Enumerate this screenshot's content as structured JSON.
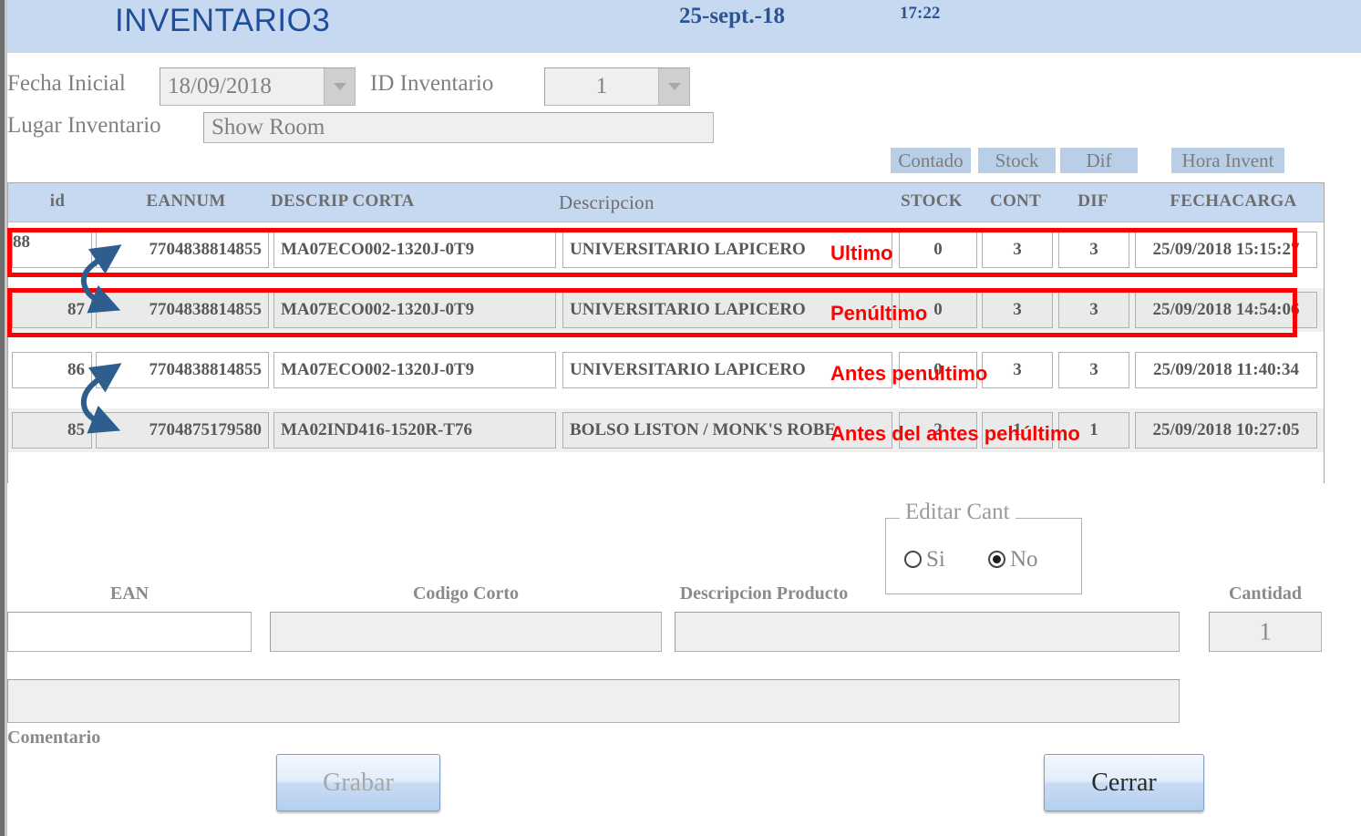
{
  "window": {
    "title": "INVENTARIO3",
    "header_date": "25-sept.-18",
    "header_time": "17:22"
  },
  "form_top": {
    "fecha_inicial_label": "Fecha Inicial",
    "fecha_inicial_value": "18/09/2018",
    "id_inventario_label": "ID Inventario",
    "id_inventario_value": "1",
    "lugar_inventario_label": "Lugar Inventario",
    "lugar_inventario_value": "Show Room"
  },
  "chips": [
    {
      "label": "Contado"
    },
    {
      "label": "Stock"
    },
    {
      "label": "Dif"
    },
    {
      "label": "Hora Invent"
    }
  ],
  "grid": {
    "columns": [
      "id",
      "EANNUM",
      "DESCRIP CORTA",
      "Descripcion",
      "STOCK",
      "CONT",
      "DIF",
      "FECHACARGA"
    ],
    "rows": [
      {
        "id": "88",
        "eannum": "7704838814855",
        "descrip_corta": "MA07ECO002-1320J-0T9",
        "descripcion": "UNIVERSITARIO LAPICERO",
        "stock": "0",
        "cont": "3",
        "dif": "3",
        "fechacarga": "25/09/2018 15:15:27"
      },
      {
        "id": "87",
        "eannum": "7704838814855",
        "descrip_corta": "MA07ECO002-1320J-0T9",
        "descripcion": "UNIVERSITARIO LAPICERO",
        "stock": "0",
        "cont": "3",
        "dif": "3",
        "fechacarga": "25/09/2018 14:54:06"
      },
      {
        "id": "86",
        "eannum": "7704838814855",
        "descrip_corta": "MA07ECO002-1320J-0T9",
        "descripcion": "UNIVERSITARIO LAPICERO",
        "stock": "0",
        "cont": "3",
        "dif": "3",
        "fechacarga": "25/09/2018 11:40:34"
      },
      {
        "id": "85",
        "eannum": "7704875179580",
        "descrip_corta": "MA02IND416-1520R-T76",
        "descripcion": "BOLSO LISTON / MONK'S ROBE",
        "stock": "2",
        "cont": "1",
        "dif": "1",
        "fechacarga": "25/09/2018 10:27:05"
      }
    ]
  },
  "annotations": {
    "color": "#ff0000",
    "labels": [
      {
        "text": "Ultimo"
      },
      {
        "text": "Penúltimo"
      },
      {
        "text": "Antes penultimo"
      },
      {
        "text": "Antes del antes pehúltimo"
      }
    ]
  },
  "editar_cant": {
    "title": "Editar Cant",
    "option_si": "Si",
    "option_no": "No",
    "selected": "No"
  },
  "form_bottom": {
    "ean_label": "EAN",
    "ean_value": "",
    "codigo_corto_label": "Codigo Corto",
    "codigo_corto_value": "",
    "descripcion_producto_label": "Descripcion Producto",
    "descripcion_producto_value": "",
    "cantidad_label": "Cantidad",
    "cantidad_value": "1",
    "comentario_label": "Comentario",
    "comentario_value": ""
  },
  "buttons": {
    "grabar": "Grabar",
    "cerrar": "Cerrar"
  }
}
